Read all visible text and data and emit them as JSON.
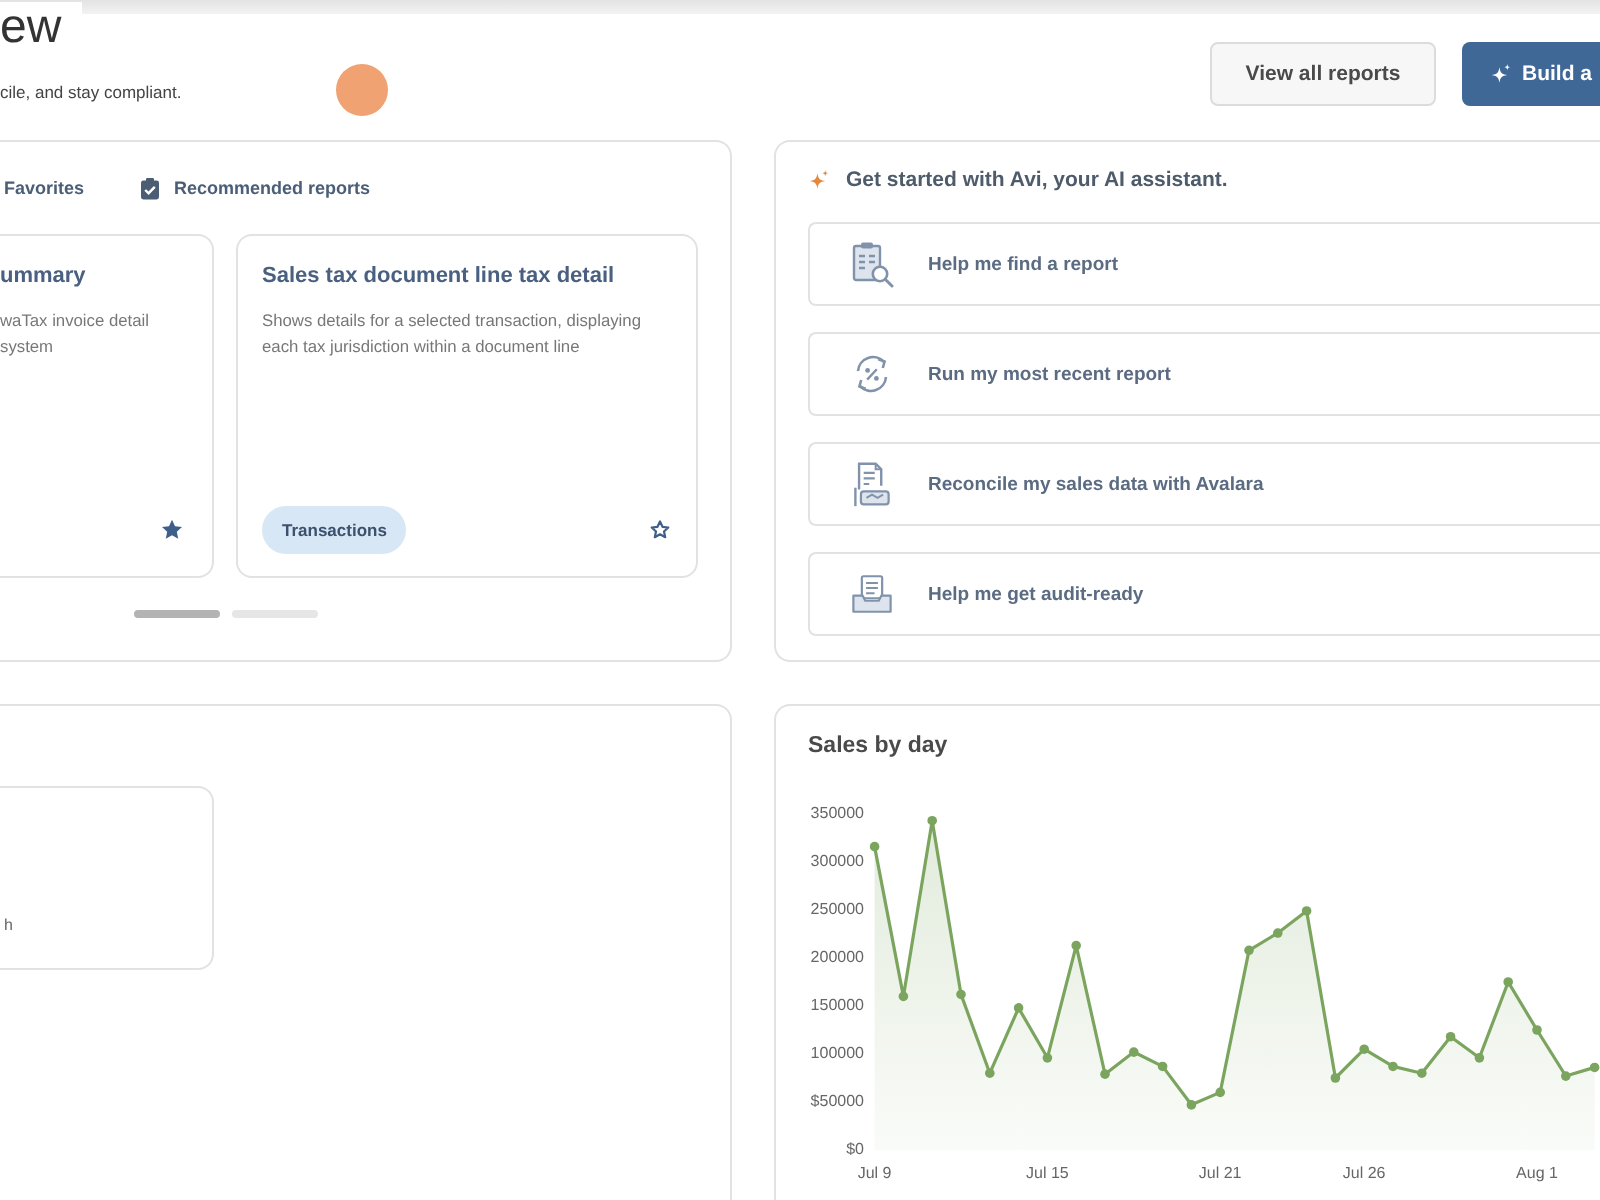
{
  "header": {
    "title": "ew",
    "subtitle": "cile, and stay compliant.",
    "buttons": [
      {
        "label": "View all reports",
        "kind": "secondary"
      },
      {
        "label": "Build a",
        "kind": "primary"
      }
    ]
  },
  "reports_panel": {
    "tabs": [
      {
        "label": "Favorites"
      },
      {
        "label": "Recommended reports"
      }
    ],
    "cards": [
      {
        "title": "ummary",
        "description": "waTax invoice detail system",
        "favorite": true
      },
      {
        "title": "Sales tax document line tax detail",
        "description": "Shows details for a selected transaction, displaying each tax jurisdiction within a document line",
        "tag": "Transactions",
        "favorite": false
      }
    ],
    "pages": [
      {
        "selected": true
      },
      {
        "selected": false
      }
    ]
  },
  "assistant_panel": {
    "title": "Get started with Avi, your AI assistant.",
    "actions": [
      "Help me find a report",
      "Run my most recent report",
      "Reconcile my sales data with Avalara",
      "Help me get audit-ready"
    ]
  },
  "panel_3": {
    "cards": [
      {
        "text": "h"
      }
    ]
  },
  "sales_panel": {
    "chart_data": {
      "type": "area",
      "title": "Sales by day",
      "categories": [
        "Jul 9",
        null,
        null,
        null,
        null,
        null,
        "Jul 15",
        null,
        null,
        null,
        null,
        null,
        "Jul 21",
        null,
        null,
        null,
        null,
        "Jul 26",
        null,
        null,
        null,
        null,
        null,
        "Aug 1",
        null,
        null
      ],
      "series": [
        {
          "color": "#7ba55f",
          "values": [
            316000,
            160000,
            343000,
            162000,
            80000,
            148000,
            96000,
            213000,
            79000,
            102000,
            87000,
            47000,
            60000,
            208000,
            226000,
            249000,
            75000,
            105000,
            87000,
            80000,
            118000,
            96000,
            175000,
            125000,
            77000,
            86000
          ]
        }
      ],
      "ylim": [
        0,
        350000
      ],
      "yticks": [
        {
          "value": 0,
          "label": "$0"
        },
        {
          "value": 50000,
          "label": "$50000"
        },
        100000,
        150000,
        200000,
        250000,
        300000,
        350000
      ]
    }
  }
}
